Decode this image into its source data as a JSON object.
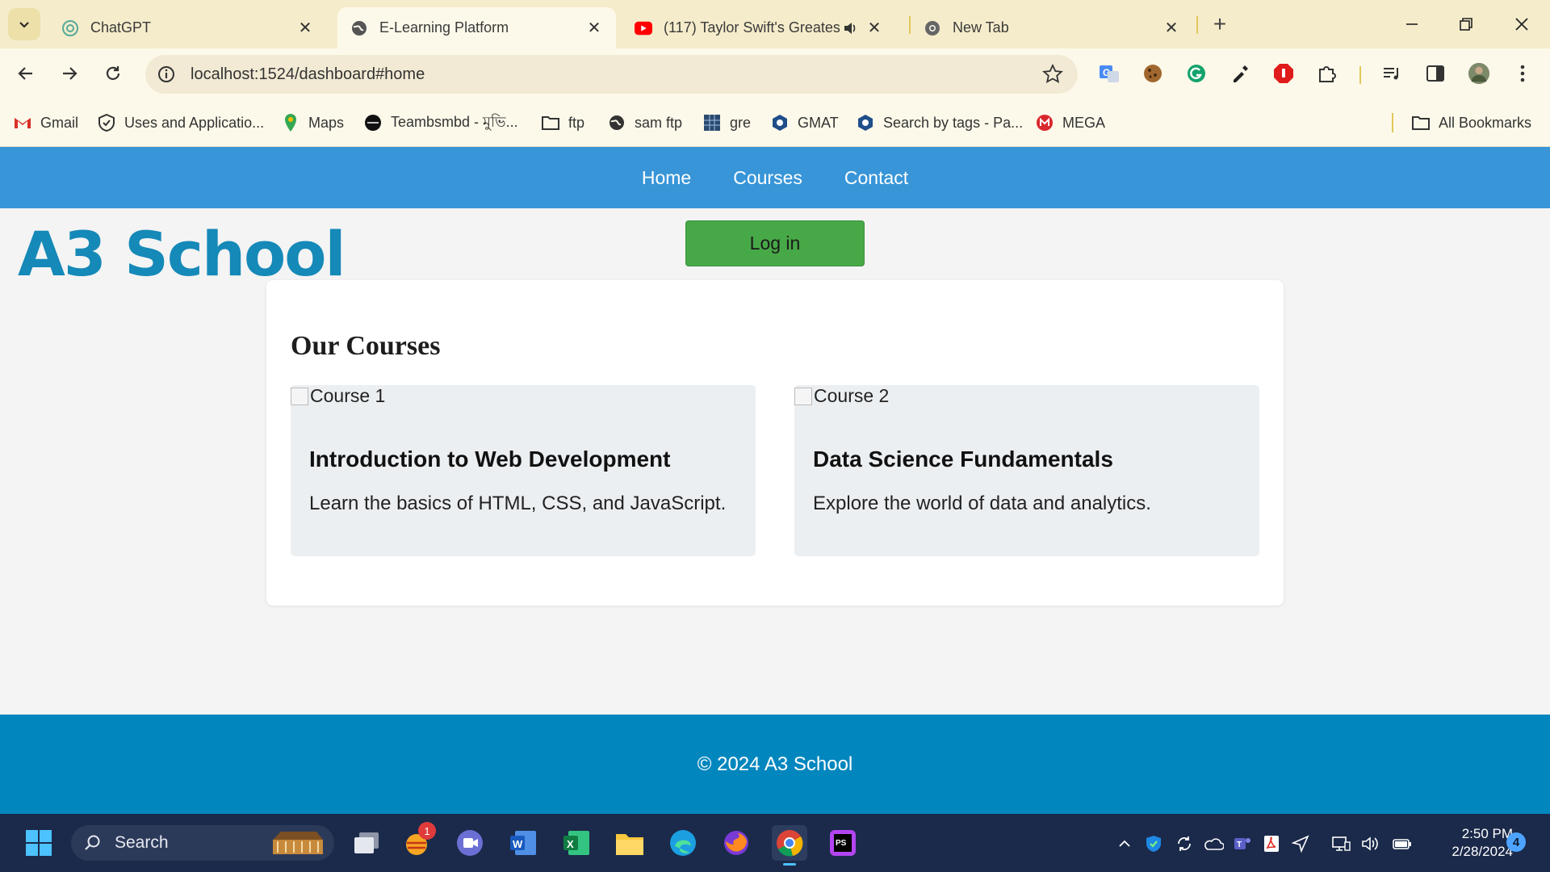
{
  "browser": {
    "tabs": [
      {
        "title": "ChatGPT",
        "icon": "chatgpt-icon",
        "active": false
      },
      {
        "title": "E-Learning Platform",
        "icon": "globe-icon",
        "active": true
      },
      {
        "title": "(117) Taylor Swift's Greatest",
        "icon": "youtube-icon",
        "active": false,
        "audio": true
      },
      {
        "title": "New Tab",
        "icon": "chrome-icon",
        "active": false
      }
    ],
    "address_bar": {
      "url": "localhost:1524/dashboard#home"
    },
    "bookmarks": [
      {
        "label": "Gmail",
        "icon": "gmail-icon"
      },
      {
        "label": "Uses and Applicatio...",
        "icon": "shield-icon"
      },
      {
        "label": "Maps",
        "icon": "maps-pin-icon"
      },
      {
        "label": "Teambsmbd - মুভি...",
        "icon": "circle-logo-icon"
      },
      {
        "label": "ftp",
        "icon": "folder-icon"
      },
      {
        "label": "sam ftp",
        "icon": "globe-icon"
      },
      {
        "label": "gre",
        "icon": "grid-logo-icon"
      },
      {
        "label": "GMAT",
        "icon": "gmat-icon"
      },
      {
        "label": "Search by tags - Pa...",
        "icon": "gmat-icon"
      },
      {
        "label": "MEGA",
        "icon": "mega-icon"
      }
    ],
    "all_bookmarks_label": "All Bookmarks",
    "colors": {
      "tabstrip": "#f5eccb",
      "toolbar": "#fdf9ea"
    }
  },
  "site": {
    "nav": [
      "Home",
      "Courses",
      "Contact"
    ],
    "logo": "A3 School",
    "login_label": "Log in",
    "courses_heading": "Our Courses",
    "courses": [
      {
        "image_alt": "Course 1",
        "title": "Introduction to Web Development",
        "description": "Learn the basics of HTML, CSS, and JavaScript."
      },
      {
        "image_alt": "Course 2",
        "title": "Data Science Fundamentals",
        "description": "Explore the world of data and analytics."
      }
    ],
    "footer": "© 2024 A3 School",
    "colors": {
      "nav": "#3895d8",
      "logo": "#1589b8",
      "login": "#47a847",
      "footer": "#0286be"
    }
  },
  "taskbar": {
    "search_label": "Search",
    "badge_count": "1",
    "time": "2:50 PM",
    "date": "2/28/2024",
    "notification_count": "4"
  }
}
